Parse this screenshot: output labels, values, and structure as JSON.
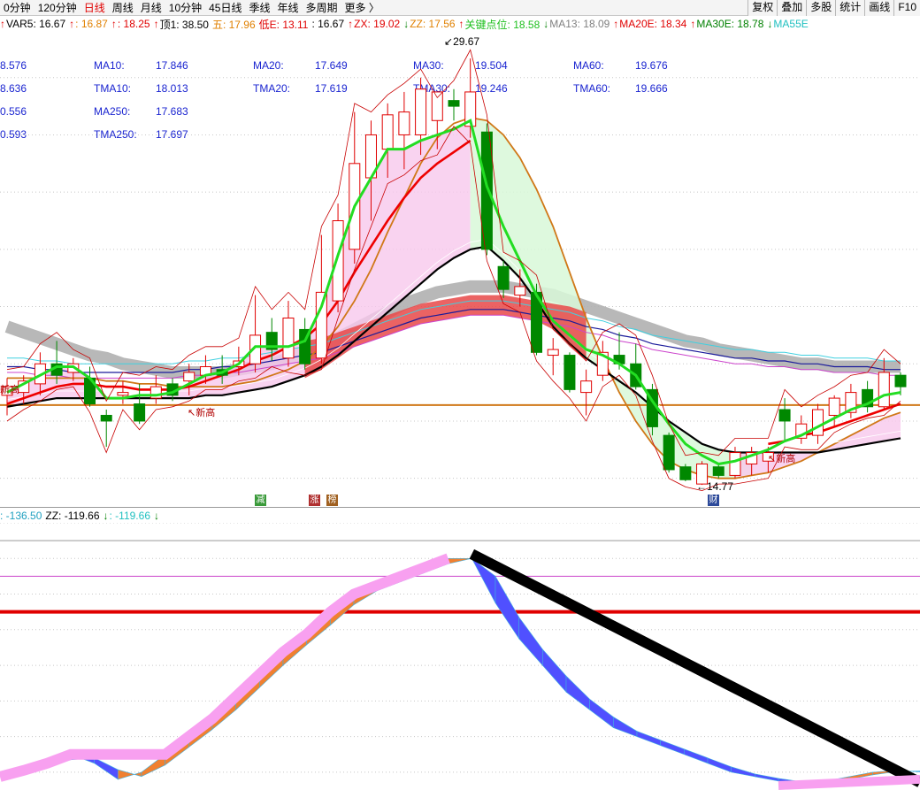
{
  "toolbar": {
    "period_tabs": [
      {
        "label": "0分钟",
        "active": false
      },
      {
        "label": "120分钟",
        "active": false
      },
      {
        "label": "日线",
        "active": true
      },
      {
        "label": "周线",
        "active": false
      },
      {
        "label": "月线",
        "active": false
      },
      {
        "label": "10分钟",
        "active": false
      },
      {
        "label": "45日线",
        "active": false
      },
      {
        "label": "季线",
        "active": false
      },
      {
        "label": "年线",
        "active": false
      },
      {
        "label": "多周期",
        "active": false
      },
      {
        "label": "更多 〉",
        "active": false
      }
    ],
    "buttons": [
      "复权",
      "叠加",
      "多股",
      "统计",
      "画线",
      "F10"
    ]
  },
  "info_line": [
    {
      "text": "↑",
      "color": "#e00000"
    },
    {
      "text": "VAR5: 16.67",
      "color": "#000000"
    },
    {
      "text": "↑",
      "color": "#e00000"
    },
    {
      "text": ": 16.87",
      "color": "#e08000"
    },
    {
      "text": "↑",
      "color": "#e00000"
    },
    {
      "text": ": 18.25",
      "color": "#e00000"
    },
    {
      "text": "↑",
      "color": "#e00000"
    },
    {
      "text": "顶1: 38.50",
      "color": "#000000"
    },
    {
      "text": "五: 17.96",
      "color": "#e08000"
    },
    {
      "text": "低E: 13.11",
      "color": "#e00000"
    },
    {
      "text": ": 16.67",
      "color": "#000000"
    },
    {
      "text": "↑",
      "color": "#e00000"
    },
    {
      "text": "ZX: 19.02",
      "color": "#e00000"
    },
    {
      "text": "↓",
      "color": "#008000"
    },
    {
      "text": "ZZ: 17.56",
      "color": "#e08000"
    },
    {
      "text": "↑",
      "color": "#e00000"
    },
    {
      "text": "关键点位: 18.58",
      "color": "#20c020"
    },
    {
      "text": "↓",
      "color": "#008000"
    },
    {
      "text": "MA13: 18.09",
      "color": "#808080"
    },
    {
      "text": "↑",
      "color": "#e00000"
    },
    {
      "text": "MA20E: 18.34",
      "color": "#e00000"
    },
    {
      "text": "↑",
      "color": "#e00000"
    },
    {
      "text": "MA30E: 18.78",
      "color": "#008000"
    },
    {
      "text": "↓",
      "color": "#008000"
    },
    {
      "text": "MA55E",
      "color": "#20c0c0"
    }
  ],
  "ma_table": [
    [
      "8.576",
      "MA10:",
      "17.846",
      "MA20:",
      "17.649",
      "MA30:",
      "19.504",
      "MA60:",
      "19.676"
    ],
    [
      "8.636",
      "TMA10:",
      "18.013",
      "TMA20:",
      "17.619",
      "TMA30:",
      "19.246",
      "TMA60:",
      "19.666"
    ],
    [
      "0.556",
      "MA250:",
      "17.683",
      "",
      "",
      "",
      "",
      "",
      ""
    ],
    [
      "0.593",
      "TMA250:",
      "17.697",
      "",
      "",
      "",
      "",
      "",
      ""
    ]
  ],
  "annotations": {
    "high_label": "29.67",
    "low_label": "14.77",
    "event_tags": [
      "新高",
      "新高",
      "新高"
    ],
    "markers": [
      "减",
      "涨",
      "榜",
      "财"
    ]
  },
  "sub_info": [
    {
      "text": ": -136.50",
      "color": "#20a0c0"
    },
    {
      "text": "ZZ: -119.66",
      "color": "#000000"
    },
    {
      "text": "↓",
      "color": "#008000"
    },
    {
      "text": ": -119.66",
      "color": "#20c0c0"
    },
    {
      "text": "↓",
      "color": "#008000"
    }
  ],
  "colors": {
    "up": "#e00000",
    "down": "#008800",
    "ma_green": "#22dd22",
    "ma_red": "#ee0000",
    "ma_black": "#000000",
    "ma_orange": "#d07818",
    "ma_blue": "#1a1a9a",
    "ma_cyan": "#40d0e0",
    "ma_magenta": "#cc44cc",
    "gray_band": "#b0b0b0",
    "pink_fill": "#f8c8ec",
    "green_fill": "#d8f8d8",
    "sub_orange": "#f08030",
    "sub_blue": "#5050ff",
    "sub_pink": "#f8a0f0",
    "sub_black": "#000000"
  },
  "chart_data": [
    {
      "type": "candlestick",
      "title": "",
      "period": "日线",
      "price_high": 29.67,
      "price_low": 14.77,
      "ylim": [
        14.0,
        30.6
      ],
      "support_line": 17.56,
      "candles": [
        {
          "o": 17.9,
          "h": 18.5,
          "l": 17.2,
          "c": 18.2
        },
        {
          "o": 18.0,
          "h": 18.6,
          "l": 17.6,
          "c": 18.4
        },
        {
          "o": 18.3,
          "h": 19.4,
          "l": 17.9,
          "c": 19.0
        },
        {
          "o": 19.0,
          "h": 19.8,
          "l": 18.3,
          "c": 18.6
        },
        {
          "o": 18.7,
          "h": 19.2,
          "l": 18.4,
          "c": 19.0
        },
        {
          "o": 18.5,
          "h": 18.9,
          "l": 17.5,
          "c": 17.6
        },
        {
          "o": 17.2,
          "h": 17.4,
          "l": 16.1,
          "c": 17.0
        },
        {
          "o": 17.9,
          "h": 18.4,
          "l": 17.6,
          "c": 18.0
        },
        {
          "o": 17.6,
          "h": 18.3,
          "l": 16.9,
          "c": 17.0
        },
        {
          "o": 17.8,
          "h": 18.6,
          "l": 17.6,
          "c": 18.2
        },
        {
          "o": 18.3,
          "h": 18.5,
          "l": 17.7,
          "c": 17.9
        },
        {
          "o": 18.4,
          "h": 19.0,
          "l": 17.9,
          "c": 18.7
        },
        {
          "o": 18.6,
          "h": 19.3,
          "l": 18.3,
          "c": 18.9
        },
        {
          "o": 18.8,
          "h": 19.3,
          "l": 18.3,
          "c": 18.6
        },
        {
          "o": 18.9,
          "h": 19.6,
          "l": 18.6,
          "c": 19.1
        },
        {
          "o": 19.0,
          "h": 21.4,
          "l": 18.7,
          "c": 20.0
        },
        {
          "o": 20.1,
          "h": 20.6,
          "l": 19.1,
          "c": 19.5
        },
        {
          "o": 19.2,
          "h": 21.2,
          "l": 18.9,
          "c": 20.6
        },
        {
          "o": 20.2,
          "h": 20.6,
          "l": 18.8,
          "c": 19.0
        },
        {
          "o": 19.2,
          "h": 23.5,
          "l": 19.0,
          "c": 21.5
        },
        {
          "o": 21.2,
          "h": 24.6,
          "l": 20.8,
          "c": 24.0
        },
        {
          "o": 23.0,
          "h": 27.8,
          "l": 22.5,
          "c": 26.0
        },
        {
          "o": 25.5,
          "h": 27.5,
          "l": 24.0,
          "c": 27.0
        },
        {
          "o": 26.5,
          "h": 28.1,
          "l": 25.5,
          "c": 27.7
        },
        {
          "o": 27.0,
          "h": 28.5,
          "l": 25.8,
          "c": 27.8
        },
        {
          "o": 27.0,
          "h": 29.0,
          "l": 26.3,
          "c": 28.6
        },
        {
          "o": 27.5,
          "h": 28.0,
          "l": 26.5,
          "c": 28.5
        },
        {
          "o": 28.2,
          "h": 28.6,
          "l": 27.5,
          "c": 28.0
        },
        {
          "o": 27.3,
          "h": 29.67,
          "l": 26.9,
          "c": 28.5
        },
        {
          "o": 27.1,
          "h": 27.4,
          "l": 22.8,
          "c": 23.0
        },
        {
          "o": 22.4,
          "h": 22.6,
          "l": 21.3,
          "c": 21.6
        },
        {
          "o": 21.4,
          "h": 22.3,
          "l": 21.0,
          "c": 21.7
        },
        {
          "o": 21.5,
          "h": 21.8,
          "l": 19.3,
          "c": 19.4
        },
        {
          "o": 19.3,
          "h": 19.9,
          "l": 18.6,
          "c": 19.5
        },
        {
          "o": 19.3,
          "h": 19.4,
          "l": 18.0,
          "c": 18.1
        },
        {
          "o": 18.0,
          "h": 18.8,
          "l": 17.2,
          "c": 18.4
        },
        {
          "o": 18.6,
          "h": 19.8,
          "l": 18.4,
          "c": 19.4
        },
        {
          "o": 19.3,
          "h": 20.1,
          "l": 18.8,
          "c": 19.0
        },
        {
          "o": 19.0,
          "h": 19.7,
          "l": 18.1,
          "c": 18.2
        },
        {
          "o": 18.1,
          "h": 18.3,
          "l": 16.5,
          "c": 16.8
        },
        {
          "o": 16.5,
          "h": 16.6,
          "l": 15.2,
          "c": 15.3
        },
        {
          "o": 15.4,
          "h": 15.5,
          "l": 14.9,
          "c": 14.95
        },
        {
          "o": 14.8,
          "h": 15.6,
          "l": 14.77,
          "c": 15.5
        },
        {
          "o": 15.4,
          "h": 15.5,
          "l": 15.0,
          "c": 15.1
        },
        {
          "o": 15.1,
          "h": 16.1,
          "l": 15.0,
          "c": 15.9
        },
        {
          "o": 15.5,
          "h": 16.1,
          "l": 15.1,
          "c": 15.9
        },
        {
          "o": 15.6,
          "h": 16.1,
          "l": 15.2,
          "c": 15.9
        },
        {
          "o": 17.4,
          "h": 17.8,
          "l": 16.3,
          "c": 17.0
        },
        {
          "o": 16.4,
          "h": 17.2,
          "l": 16.2,
          "c": 16.9
        },
        {
          "o": 16.5,
          "h": 17.6,
          "l": 16.2,
          "c": 17.4
        },
        {
          "o": 17.2,
          "h": 17.9,
          "l": 16.8,
          "c": 17.8
        },
        {
          "o": 17.3,
          "h": 18.3,
          "l": 17.1,
          "c": 18.0
        },
        {
          "o": 18.1,
          "h": 18.4,
          "l": 17.3,
          "c": 17.5
        },
        {
          "o": 17.5,
          "h": 19.2,
          "l": 17.4,
          "c": 18.7
        },
        {
          "o": 18.6,
          "h": 18.7,
          "l": 17.9,
          "c": 18.2
        }
      ],
      "lines": {
        "green_fast": [
          18.0,
          18.3,
          18.6,
          18.9,
          18.9,
          18.5,
          17.8,
          17.8,
          17.9,
          17.9,
          18.0,
          18.3,
          18.6,
          18.7,
          19.0,
          19.6,
          19.6,
          19.6,
          19.8,
          21.0,
          22.8,
          24.5,
          25.5,
          26.5,
          26.5,
          26.8,
          27.0,
          27.2,
          27.5,
          25.2,
          23.8,
          22.6,
          21.4,
          20.5,
          20.0,
          19.5,
          19.3,
          19.0,
          18.6,
          17.7,
          16.9,
          16.2,
          15.8,
          15.5,
          15.6,
          15.8,
          16.0,
          16.3,
          16.5,
          16.8,
          17.1,
          17.4,
          17.6,
          17.9,
          18.0
        ],
        "red_mid": [
          17.6,
          17.8,
          18.0,
          18.2,
          18.3,
          18.3,
          18.2,
          18.2,
          18.1,
          18.1,
          18.1,
          18.2,
          18.4,
          18.6,
          18.8,
          19.1,
          19.3,
          19.6,
          19.9,
          20.4,
          21.2,
          22.2,
          23.1,
          24.0,
          24.8,
          25.5,
          26.0,
          26.4,
          26.8,
          null,
          null,
          null,
          null,
          null,
          null,
          null,
          null,
          null,
          null,
          null,
          null,
          null,
          null,
          null,
          null,
          null,
          16.2,
          16.3,
          16.5,
          16.6,
          16.8,
          17.0,
          17.2,
          17.4,
          17.6
        ],
        "black_slow": [
          17.5,
          17.6,
          17.7,
          17.8,
          17.8,
          17.8,
          17.8,
          17.8,
          17.8,
          17.8,
          17.8,
          17.8,
          17.9,
          17.9,
          18.0,
          18.1,
          18.2,
          18.4,
          18.6,
          18.9,
          19.3,
          19.8,
          20.3,
          20.8,
          21.3,
          21.8,
          22.3,
          22.7,
          23.0,
          23.1,
          22.6,
          22.0,
          21.2,
          20.3,
          19.7,
          19.2,
          18.8,
          18.4,
          18.0,
          17.5,
          17.0,
          16.6,
          16.2,
          16.0,
          15.9,
          15.9,
          15.9,
          15.9,
          15.9,
          15.9,
          16.0,
          16.1,
          16.2,
          16.3,
          16.4
        ],
        "orange_band": [
          18.5,
          18.5,
          18.5,
          18.5,
          18.5,
          18.5,
          18.4,
          18.4,
          18.3,
          18.3,
          18.2,
          18.2,
          18.2,
          18.2,
          18.3,
          18.4,
          18.6,
          18.8,
          19.1,
          19.6,
          20.3,
          21.2,
          22.3,
          23.6,
          24.8,
          26.0,
          26.9,
          27.4,
          27.6,
          27.5,
          27.0,
          26.2,
          25.1,
          23.8,
          22.2,
          20.6,
          19.2,
          18.0,
          17.0,
          16.2,
          15.6,
          15.3,
          15.1,
          15.0,
          15.0,
          15.1,
          15.2,
          15.4,
          15.6,
          15.9,
          16.2,
          16.5,
          16.8,
          17.1,
          17.3
        ],
        "blue_long": [
          18.9,
          18.9,
          18.8,
          18.8,
          18.7,
          18.7,
          18.7,
          18.7,
          18.7,
          18.7,
          18.7,
          18.8,
          18.8,
          18.9,
          18.9,
          19.0,
          19.1,
          19.2,
          19.3,
          19.4,
          19.6,
          19.8,
          20.0,
          20.2,
          20.4,
          20.6,
          20.7,
          20.8,
          20.9,
          20.9,
          20.9,
          20.8,
          20.7,
          20.6,
          20.5,
          20.3,
          20.2,
          20.0,
          19.9,
          19.7,
          19.6,
          19.5,
          19.4,
          19.3,
          19.2,
          19.2,
          19.1,
          19.1,
          19.0,
          19.0,
          18.9,
          18.9,
          18.9,
          18.8,
          18.8
        ],
        "gray_band": [
          20.3,
          20.1,
          19.9,
          19.7,
          19.5,
          19.3,
          19.2,
          19.0,
          18.9,
          18.8,
          18.7,
          18.7,
          18.7,
          18.7,
          18.8,
          18.9,
          19.0,
          19.2,
          19.4,
          19.6,
          19.9,
          20.2,
          20.5,
          20.8,
          21.1,
          21.3,
          21.5,
          21.6,
          21.7,
          21.7,
          21.7,
          21.6,
          21.5,
          21.4,
          21.2,
          21.0,
          20.8,
          20.6,
          20.4,
          20.2,
          20.0,
          19.8,
          19.7,
          19.5,
          19.4,
          19.3,
          19.2,
          19.1,
          19.0,
          19.0,
          18.9,
          18.9,
          18.9,
          18.9,
          18.9
        ]
      }
    },
    {
      "type": "area",
      "title": "",
      "series": [
        {
          "name": "ZZ",
          "value": -119.66
        }
      ],
      "ylim": [
        -140,
        160
      ],
      "levels": [
        100,
        60,
        0
      ],
      "values": [
        -125,
        -118,
        -110,
        -100,
        -110,
        -128,
        -120,
        -100,
        -80,
        -60,
        -35,
        -10,
        15,
        35,
        60,
        80,
        90,
        100,
        110,
        120,
        120,
        70,
        30,
        0,
        -30,
        -50,
        -70,
        -80,
        -90,
        -100,
        -110,
        -120,
        -125,
        -130,
        -132,
        -130,
        -125,
        -120,
        -118,
        -119.66
      ]
    }
  ]
}
